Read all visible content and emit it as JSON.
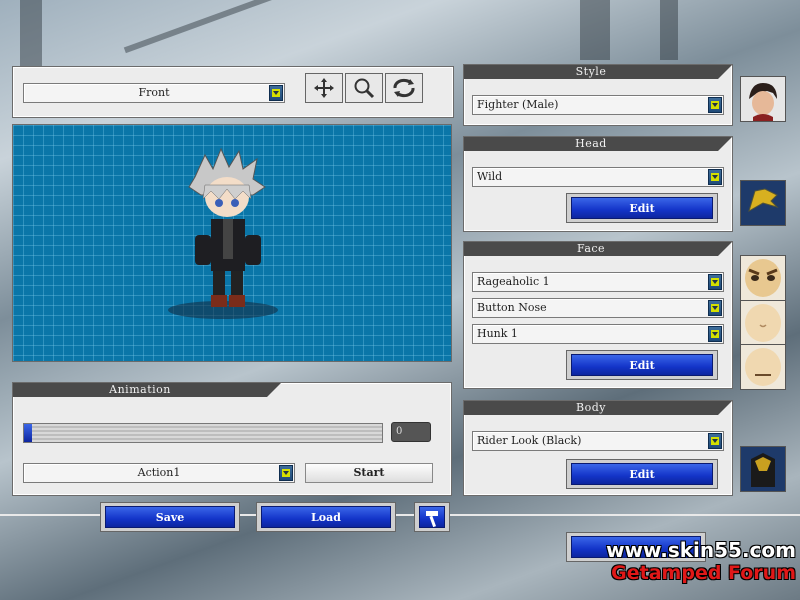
{
  "view": {
    "options": [
      "Front"
    ],
    "selected": "Front"
  },
  "tools": {
    "move": "move-icon",
    "zoom": "magnifier-icon",
    "rotate": "rotate-icon"
  },
  "style": {
    "title": "Style",
    "value": "Fighter (Male)"
  },
  "head": {
    "title": "Head",
    "value": "Wild",
    "edit_label": "Edit"
  },
  "face": {
    "title": "Face",
    "eyes": "Rageaholic 1",
    "nose": "Button Nose",
    "mouth": "Hunk 1",
    "edit_label": "Edit"
  },
  "body": {
    "title": "Body",
    "value": "Rider Look (Black)",
    "edit_label": "Edit"
  },
  "animation": {
    "title": "Animation",
    "frame": "0",
    "progress": 0.0,
    "action": "Action1",
    "start_label": "Start"
  },
  "actions": {
    "save_label": "Save",
    "load_label": "Load"
  },
  "watermark": {
    "url": "www.skin55.com",
    "forum": "Getamped Forum"
  },
  "colors": {
    "accent_blue": "#1334c8",
    "grid": "#0f86b8",
    "panel": "#ececec"
  }
}
